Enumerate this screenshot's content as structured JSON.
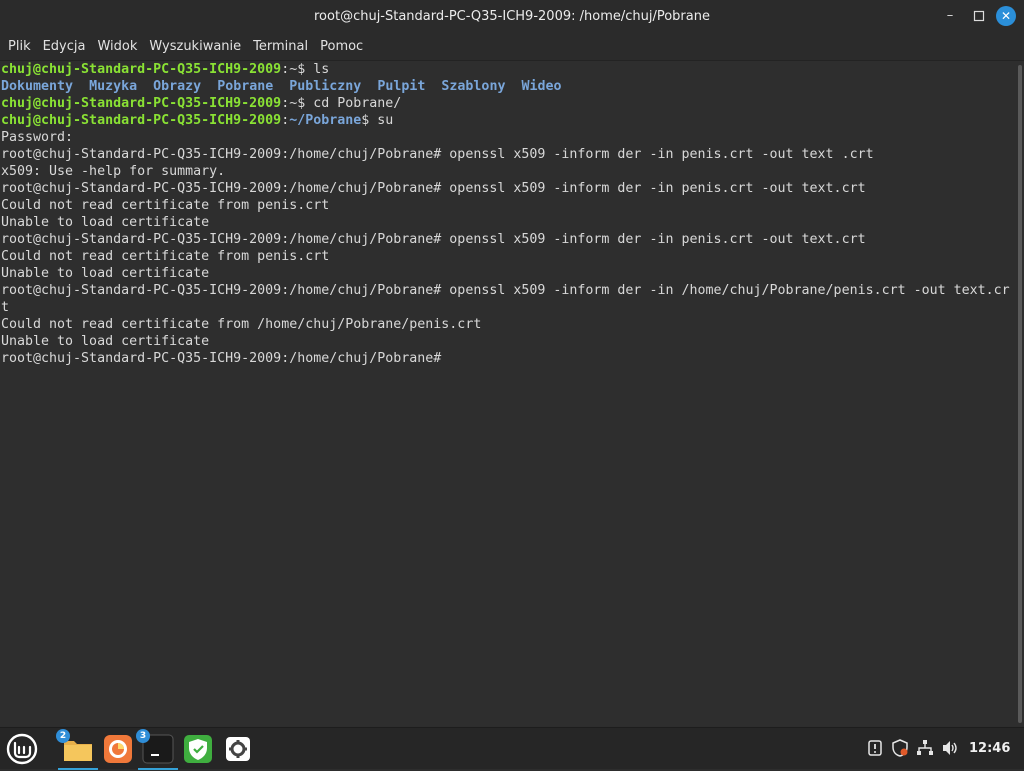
{
  "window": {
    "title": "root@chuj-Standard-PC-Q35-ICH9-2009: /home/chuj/Pobrane",
    "minimize_glyph": "–",
    "maximize_glyph": "□",
    "close_glyph": "✕"
  },
  "menu": [
    "Plik",
    "Edycja",
    "Widok",
    "Wyszukiwanie",
    "Terminal",
    "Pomoc"
  ],
  "terminal": {
    "lines": [
      [
        {
          "t": "chuj@chuj-Standard-PC-Q35-ICH9-2009",
          "c": "green"
        },
        {
          "t": ":~$ ls",
          "c": "plain"
        }
      ],
      [
        {
          "t": "Dokumenty",
          "c": "dir"
        },
        {
          "t": "  ",
          "c": "plain"
        },
        {
          "t": "Muzyka",
          "c": "dir"
        },
        {
          "t": "  ",
          "c": "plain"
        },
        {
          "t": "Obrazy",
          "c": "dir"
        },
        {
          "t": "  ",
          "c": "plain"
        },
        {
          "t": "Pobrane",
          "c": "dir"
        },
        {
          "t": "  ",
          "c": "plain"
        },
        {
          "t": "Publiczny",
          "c": "dir"
        },
        {
          "t": "  ",
          "c": "plain"
        },
        {
          "t": "Pulpit",
          "c": "dir"
        },
        {
          "t": "  ",
          "c": "plain"
        },
        {
          "t": "Szablony",
          "c": "dir"
        },
        {
          "t": "  ",
          "c": "plain"
        },
        {
          "t": "Wideo",
          "c": "dir"
        }
      ],
      [
        {
          "t": "chuj@chuj-Standard-PC-Q35-ICH9-2009",
          "c": "green"
        },
        {
          "t": ":~$ cd Pobrane/",
          "c": "plain"
        }
      ],
      [
        {
          "t": "chuj@chuj-Standard-PC-Q35-ICH9-2009",
          "c": "green"
        },
        {
          "t": ":",
          "c": "plain"
        },
        {
          "t": "~/Pobrane",
          "c": "dir"
        },
        {
          "t": "$ su",
          "c": "plain"
        }
      ],
      [
        {
          "t": "Password:",
          "c": "plain"
        }
      ],
      [
        {
          "t": "root@chuj-Standard-PC-Q35-ICH9-2009:/home/chuj/Pobrane# openssl x509 -inform der -in penis.crt -out text .crt",
          "c": "plain"
        }
      ],
      [
        {
          "t": "x509: Use -help for summary.",
          "c": "plain"
        }
      ],
      [
        {
          "t": "root@chuj-Standard-PC-Q35-ICH9-2009:/home/chuj/Pobrane# openssl x509 -inform der -in penis.crt -out text.crt",
          "c": "plain"
        }
      ],
      [
        {
          "t": "Could not read certificate from penis.crt",
          "c": "plain"
        }
      ],
      [
        {
          "t": "Unable to load certificate",
          "c": "plain"
        }
      ],
      [
        {
          "t": "root@chuj-Standard-PC-Q35-ICH9-2009:/home/chuj/Pobrane# openssl x509 -inform der -in penis.crt -out text.crt",
          "c": "plain"
        }
      ],
      [
        {
          "t": "Could not read certificate from penis.crt",
          "c": "plain"
        }
      ],
      [
        {
          "t": "Unable to load certificate",
          "c": "plain"
        }
      ],
      [
        {
          "t": "root@chuj-Standard-PC-Q35-ICH9-2009:/home/chuj/Pobrane# openssl x509 -inform der -in /home/chuj/Pobrane/penis.crt -out text.cr",
          "c": "plain"
        }
      ],
      [
        {
          "t": "t",
          "c": "plain"
        }
      ],
      [
        {
          "t": "Could not read certificate from /home/chuj/Pobrane/penis.crt",
          "c": "plain"
        }
      ],
      [
        {
          "t": "Unable to load certificate",
          "c": "plain"
        }
      ],
      [
        {
          "t": "root@chuj-Standard-PC-Q35-ICH9-2009:/home/chuj/Pobrane#",
          "c": "plain"
        }
      ]
    ]
  },
  "taskbar": {
    "items": [
      {
        "name": "menu-button",
        "icon": "linux-mint-logo-icon"
      },
      {
        "name": "files-app",
        "icon": "folder-icon",
        "badge": "2"
      },
      {
        "name": "firefox-app",
        "icon": "firefox-icon"
      },
      {
        "name": "terminal-app",
        "icon": "terminal-icon",
        "badge": "3"
      },
      {
        "name": "update-manager-app",
        "icon": "shield-check-icon"
      },
      {
        "name": "settings-app",
        "icon": "gear-icon"
      }
    ],
    "tray": [
      "notification-icon",
      "update-shield-icon",
      "network-icon",
      "volume-icon"
    ],
    "clock": "12:46"
  },
  "colors": {
    "prompt_green": "#8ae234",
    "dir_blue": "#7aa6da",
    "accent": "#35a2d8",
    "bg": "#2e2e2e"
  }
}
